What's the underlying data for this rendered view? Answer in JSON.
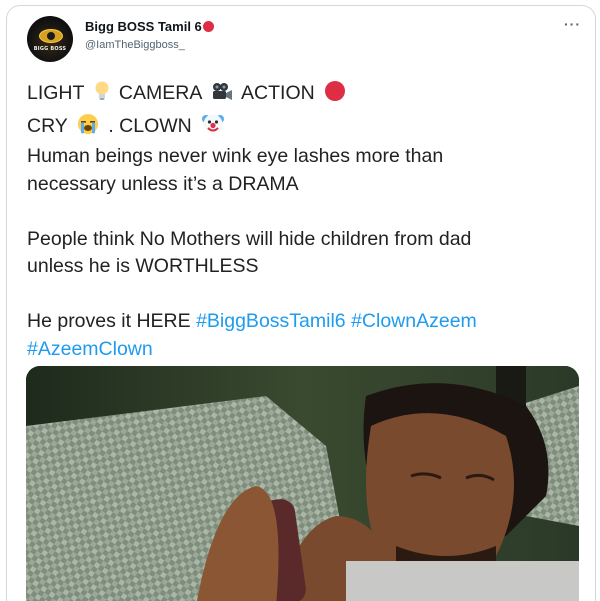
{
  "tweet": {
    "author": {
      "display_name": "Bigg BOSS Tamil 6",
      "handle": "@IamTheBiggboss_",
      "avatar_text": "BIGG BOSS",
      "verified_badge_color": "#dd2e44"
    },
    "more_label": "···",
    "lines": {
      "l1_a": "LIGHT",
      "l1_b": "CAMERA",
      "l1_c": "ACTION",
      "l2_a": "CRY",
      "l2_b": ".  CLOWN",
      "l3": "Human beings never wink eye lashes more than",
      "l4": "necessary unless it’s a DRAMA",
      "l5": "People think No Mothers will hide children from dad",
      "l6": "unless he is WORTHLESS",
      "l7": "He proves it HERE"
    },
    "hashtags": [
      "#BiggBossTamil6",
      "#ClownAzeem",
      "#AzeemClown"
    ],
    "emojis": [
      "light-bulb",
      "movie-camera",
      "red-circle",
      "crying-face",
      "clown-face"
    ],
    "media": {
      "description_type": "video-still",
      "colors": {
        "background": "#2c3a2a",
        "cushion": "#8c9a88",
        "skin": "#7a4a2e",
        "hair": "#1c1410",
        "phone": "#5a2a2a"
      }
    },
    "colors": {
      "link": "#1d9bf0",
      "text": "#0f1419",
      "muted": "#536471",
      "border": "#cfd9de"
    }
  }
}
